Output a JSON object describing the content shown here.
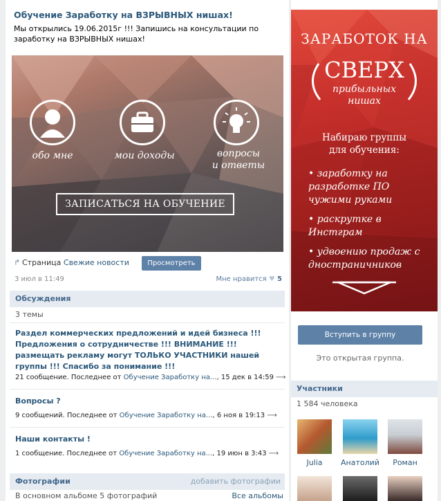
{
  "post": {
    "title": "Обучение Заработку на ВЗРЫВНЫХ нишах!",
    "text": "Мы открылись 19.06.2015г !!! Запишись на консультации по заработку на ВЗРЫВНЫХ нишах!",
    "banner": {
      "items": [
        {
          "icon": "user-icon",
          "label": "обо мне"
        },
        {
          "icon": "briefcase-icon",
          "label": "мои доходы"
        },
        {
          "icon": "lightbulb-icon",
          "label": "вопросы\nи ответы"
        }
      ],
      "cta": "ЗАПИСАТЬСЯ НА ОБУЧЕНИЕ"
    },
    "source_prefix": "Страница",
    "source_link": "Свежие новости",
    "view_button": "Просмотреть",
    "date": "3 июл в 11:49",
    "likes_label": "Мне нравится",
    "likes_count": "5"
  },
  "discussions": {
    "title": "Обсуждения",
    "count": "3 темы",
    "topics": [
      {
        "title": "Раздел коммерческих предложений и идей бизнеса !!! Предложения о сотрудничестве !!! ВНИМАНИЕ !!! размещать рекламу могут ТОЛЬКО УЧАСТНИКИ нашей группы !!! Спасибо за понимание !!!",
        "meta_prefix": "21 сообщение. Последнее от",
        "meta_author": "Обучение Заработку на...",
        "meta_date": ", 15 дек в 14:59",
        "arrow": "⟶"
      },
      {
        "title": "Вопросы ?",
        "meta_prefix": "9 сообщений. Последнее от",
        "meta_author": "Обучение Заработку на...",
        "meta_date": ", 6 ноя в 19:13",
        "arrow": "⟶"
      },
      {
        "title": "Наши контакты !",
        "meta_prefix": "1 сообщение. Последнее от",
        "meta_author": "Обучение Заработку на...",
        "meta_date": ", 19 июн в 3:43",
        "arrow": "⟶"
      }
    ]
  },
  "photos": {
    "title": "Фотографии",
    "add_link": "добавить фотографии",
    "album_text": "В основном альбоме 5 фотографий",
    "all_albums": "Все альбомы"
  },
  "ad": {
    "line1": "ЗАРАБОТОК НА",
    "line2": "СВЕРХ",
    "line3": "прибыльных\nнишах",
    "body": "Набираю группы\nдля обучения:",
    "bullets": [
      "• заработку на разработке ПО чужими руками",
      "• раскрутке в Инстграм",
      "• удвоению продаж с дностраничников"
    ]
  },
  "join_button": "Вступить в группу",
  "open_group": "Это открытая группа.",
  "members": {
    "title": "Участники",
    "count": "1 584 человека",
    "people": [
      {
        "name": "Julia",
        "color": "#c77b4a"
      },
      {
        "name": "Анатолий",
        "color": "#3f8fb0"
      },
      {
        "name": "Роман",
        "color": "#8e9aa6"
      }
    ]
  }
}
